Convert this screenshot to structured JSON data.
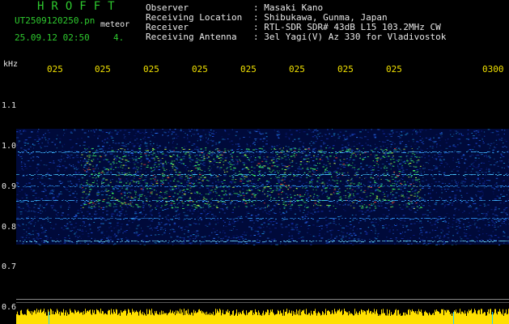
{
  "header": {
    "logo_text": "HROFFT",
    "filename": "UT2509120250.pn",
    "meteor_label": "meteor",
    "datetime": "25.09.12 02:50",
    "count": "4."
  },
  "info": {
    "observer_label": "Observer",
    "observer_value": ": Masaki Kano",
    "location_label": "Receiving Location",
    "location_value": ": Shibukawa, Gunma, Japan",
    "receiver_label": "Receiver",
    "receiver_value": ": RTL-SDR SDR# 43dB L15 103.2MHz CW",
    "antenna_label": "Receiving Antenna",
    "antenna_value": ": 3el Yagi(V) Az 330 for Vladivostok"
  },
  "axis": {
    "unit": "kHz",
    "time_ticks": [
      "025",
      "025",
      "025",
      "025",
      "025",
      "025",
      "025",
      "025",
      "0300"
    ],
    "freq_ticks": [
      "1.1",
      "1.0",
      "0.9",
      "0.8",
      "0.7",
      "0.6"
    ]
  },
  "colors": {
    "background": "#000000",
    "title_green": "#2ec92e",
    "tick_yellow": "#f0e000",
    "text_white": "#e8e8e8"
  }
}
